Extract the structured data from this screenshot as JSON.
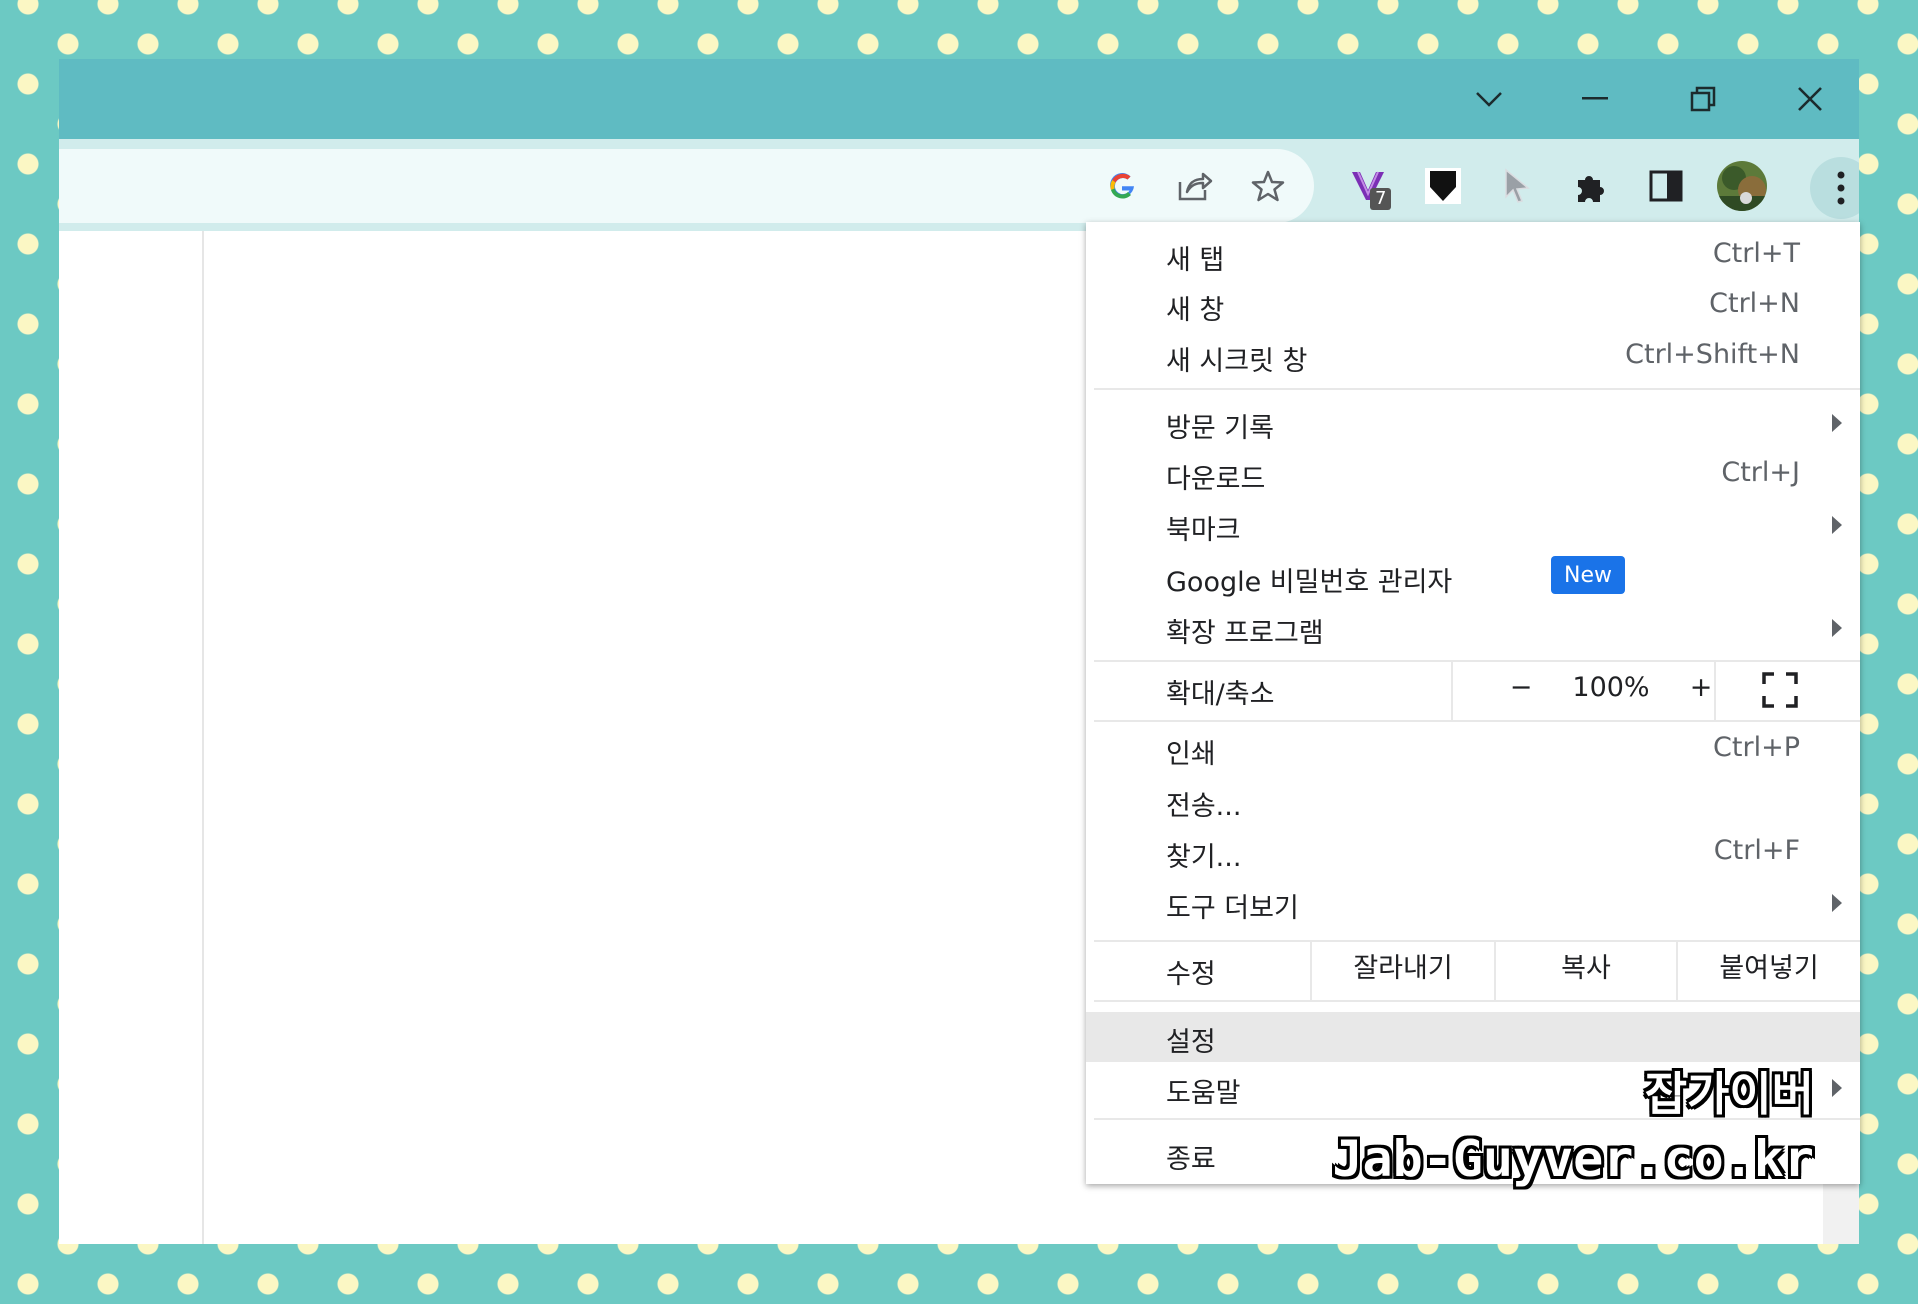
{
  "window": {
    "controls": {
      "tabsearch_icon": "chevron-down-icon",
      "minimize_icon": "minimize-icon",
      "restore_icon": "restore-icon",
      "close_icon": "close-icon"
    }
  },
  "toolbar": {
    "extensions_badge": "7",
    "icons": [
      "google-icon",
      "share-icon",
      "star-icon",
      "extension-v-icon",
      "shield-icon",
      "cursor-icon",
      "puzzle-icon",
      "side-panel-icon",
      "avatar",
      "more-vert-icon"
    ]
  },
  "menu": {
    "new_tab": {
      "label": "새 탭",
      "shortcut": "Ctrl+T"
    },
    "new_window": {
      "label": "새 창",
      "shortcut": "Ctrl+N"
    },
    "incognito": {
      "label": "새 시크릿 창",
      "shortcut": "Ctrl+Shift+N"
    },
    "history": {
      "label": "방문 기록"
    },
    "downloads": {
      "label": "다운로드",
      "shortcut": "Ctrl+J"
    },
    "bookmarks": {
      "label": "북마크"
    },
    "password_manager": {
      "label": "Google 비밀번호 관리자",
      "badge": "New"
    },
    "extensions": {
      "label": "확장 프로그램"
    },
    "zoom": {
      "label": "확대/축소",
      "minus": "−",
      "value": "100%",
      "plus": "+"
    },
    "print": {
      "label": "인쇄",
      "shortcut": "Ctrl+P"
    },
    "cast": {
      "label": "전송..."
    },
    "find": {
      "label": "찾기...",
      "shortcut": "Ctrl+F"
    },
    "more_tools": {
      "label": "도구 더보기"
    },
    "edit": {
      "label": "수정",
      "cut": "잘라내기",
      "copy": "복사",
      "paste": "붙여넣기"
    },
    "settings": {
      "label": "설정"
    },
    "help": {
      "label": "도움말"
    },
    "exit": {
      "label": "종료"
    }
  },
  "watermark": {
    "korean": "잡가이버",
    "url": "Jab-Guyver.co.kr"
  },
  "colors": {
    "titlebar": "#5fbbc2",
    "toolbar": "#d1ecec",
    "badge_blue": "#1a73e8",
    "page_bg": "#6cc9c3",
    "dots": "#fbf7c4"
  }
}
